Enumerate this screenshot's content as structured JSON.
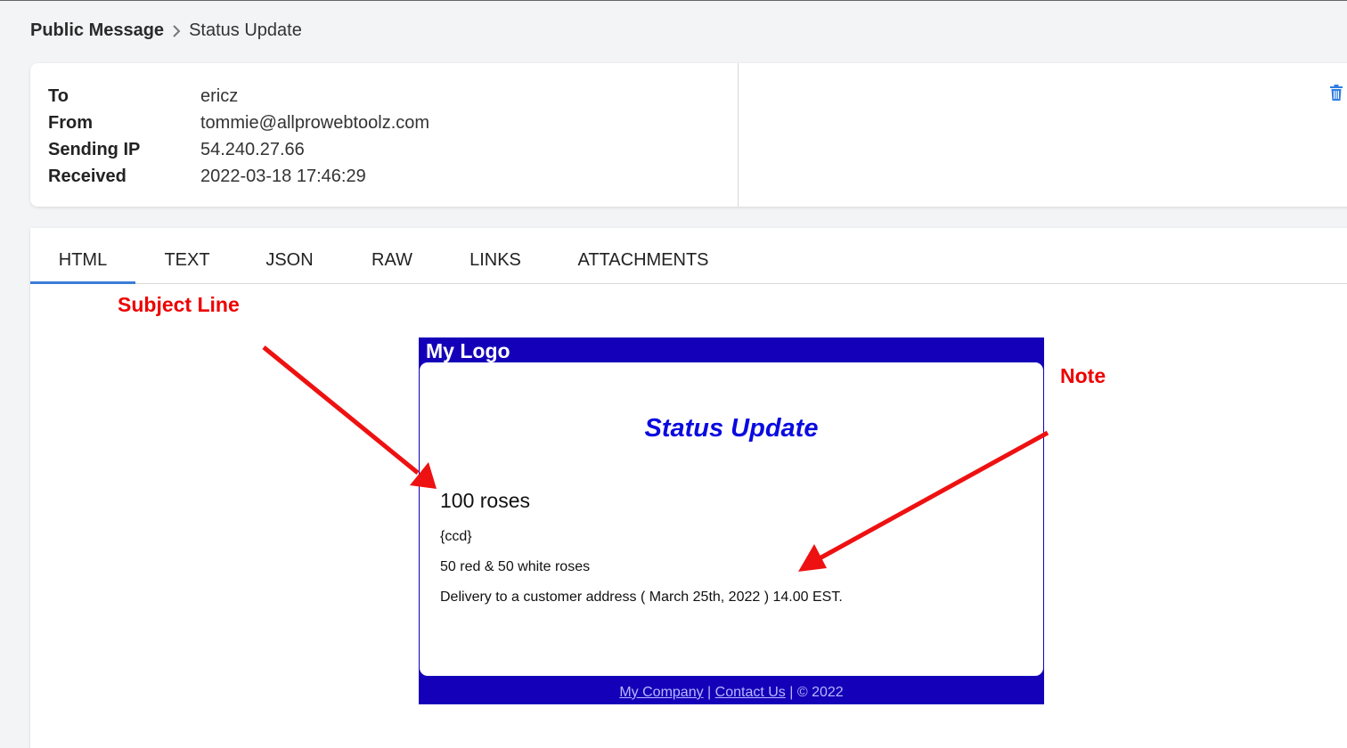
{
  "breadcrumb": {
    "parent": "Public Message",
    "current": "Status Update"
  },
  "meta": {
    "rows": [
      {
        "label": "To",
        "value": "ericz"
      },
      {
        "label": "From",
        "value": "tommie@allprowebtoolz.com"
      },
      {
        "label": "Sending IP",
        "value": "54.240.27.66"
      },
      {
        "label": "Received",
        "value": "2022-03-18 17:46:29"
      }
    ]
  },
  "tabs": [
    {
      "label": "HTML",
      "active": true
    },
    {
      "label": "TEXT"
    },
    {
      "label": "JSON"
    },
    {
      "label": "RAW"
    },
    {
      "label": "LINKS"
    },
    {
      "label": "ATTACHMENTS"
    }
  ],
  "annotations": {
    "subject": "Subject Line",
    "note": "Note"
  },
  "email": {
    "logo": "My Logo",
    "title": "Status Update",
    "heading": "100 roses",
    "lines": [
      "{ccd}",
      "50 red & 50 white roses",
      "Delivery to a customer address ( March 25th, 2022 ) 14.00 EST."
    ],
    "footer": {
      "company": "My Company",
      "sep1": " | ",
      "contact": "Contact Us",
      "copyright": " | © 2022"
    }
  },
  "colors": {
    "accent": "#3b7dd8",
    "annotation": "#ee0000",
    "email_brand": "#1400b8",
    "email_title": "#0a0ae0"
  },
  "icons": {
    "breadcrumb_sep": "chevron-right-icon",
    "delete": "trash-icon"
  }
}
